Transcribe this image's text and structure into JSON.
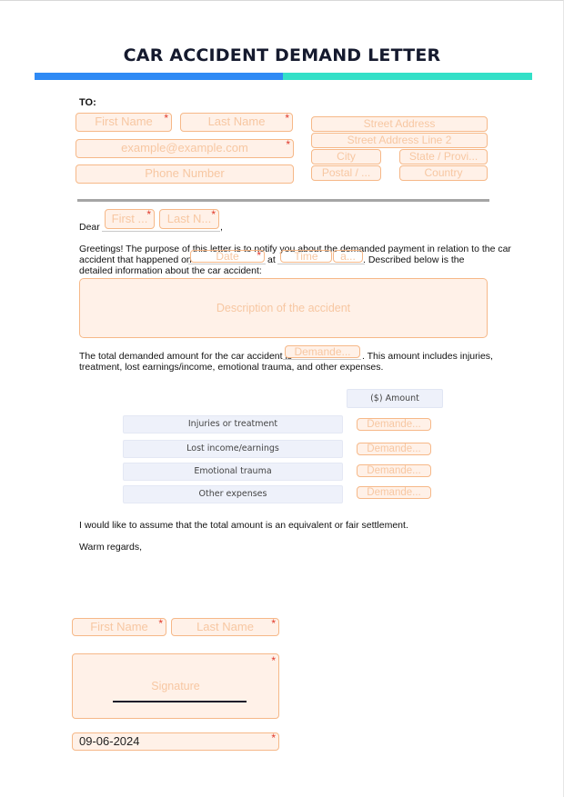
{
  "title": "CAR ACCIDENT DEMAND LETTER",
  "colors": {
    "bar_left": "#2f8af5",
    "bar_right": "#33e0c8",
    "field_bg": "#fff1e8",
    "field_border": "#f6b888",
    "placeholder": "#f7c7a2",
    "required": "#e0392b",
    "table_bg": "#eef1fa"
  },
  "recipient": {
    "label": "TO:",
    "first_name": {
      "placeholder": "First Name",
      "required": true
    },
    "last_name": {
      "placeholder": "Last Name",
      "required": true
    },
    "email": {
      "placeholder": "example@example.com",
      "required": true
    },
    "phone": {
      "placeholder": "Phone Number",
      "required": false
    },
    "street": {
      "placeholder": "Street Address"
    },
    "street2": {
      "placeholder": "Street Address Line 2"
    },
    "city": {
      "placeholder": "City"
    },
    "state": {
      "placeholder": "State / Provi..."
    },
    "postal": {
      "placeholder": "Postal / ..."
    },
    "country": {
      "placeholder": "Country"
    }
  },
  "salutation": {
    "dear": "Dear",
    "first_name": {
      "placeholder": "First ...",
      "required": true
    },
    "last_name": {
      "placeholder": "Last N...",
      "required": true
    },
    "comma": ","
  },
  "body": {
    "greeting_line1": "Greetings! The purpose of this letter is to notify you about the demanded payment in relation to the car",
    "greeting_line2_start": "accident that happened on",
    "date_field": {
      "placeholder": "Date",
      "required": true
    },
    "at": "at",
    "time_field": {
      "placeholder": "Time"
    },
    "ampm_field": {
      "placeholder": "a..."
    },
    "greeting_line2_end": ". Described below is the",
    "greeting_line3": "detailed information about the car accident:",
    "description": {
      "placeholder": "Description of the accident"
    },
    "total_line1_start": "The total demanded amount for the car accident is",
    "total_field": {
      "placeholder": "Demande..."
    },
    "total_line1_end": ". This amount includes injuries,",
    "total_line2": "treatment, lost earnings/income, emotional trauma, and other expenses."
  },
  "table": {
    "amount_header": "($) Amount",
    "rows": [
      {
        "label": "Injuries or treatment",
        "placeholder": "Demande..."
      },
      {
        "label": "Lost income/earnings",
        "placeholder": "Demande..."
      },
      {
        "label": "Emotional trauma",
        "placeholder": "Demande..."
      },
      {
        "label": "Other expenses",
        "placeholder": "Demande..."
      }
    ]
  },
  "closing": {
    "settlement": "I would like to assume that the total amount is an equivalent or fair settlement.",
    "regards": "Warm regards,"
  },
  "sender": {
    "first_name": {
      "placeholder": "First Name",
      "required": true
    },
    "last_name": {
      "placeholder": "Last Name",
      "required": true
    },
    "signature": {
      "placeholder": "Signature",
      "required": true
    },
    "date": {
      "value": "09-06-2024",
      "required": true
    }
  },
  "required_mark": "*"
}
